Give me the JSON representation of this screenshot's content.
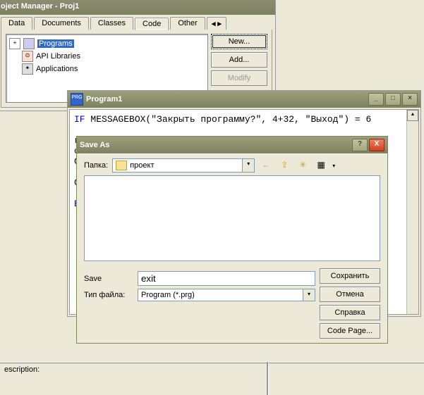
{
  "pm": {
    "title": "oject Manager - Proj1",
    "tabs": {
      "data": "Data",
      "documents": "Documents",
      "classes": "Classes",
      "code": "Code",
      "other": "Other",
      "add": "◂  ▸"
    },
    "tree": {
      "programs": "Programs",
      "api": "API Libraries",
      "apps": "Applications"
    },
    "buttons": {
      "new": "New...",
      "add": "Add...",
      "modify": "Modify"
    }
  },
  "ed": {
    "title": "Program1",
    "code": {
      "l1a": "IF",
      "l1b": " MESSAGEBOX(\"Закрыть программу?\", 4+32, \"Выход\") = 6",
      "l2": "   re",
      "l3": "clear",
      "l4": "   Cl",
      "l5": "   Cl",
      "l6": "ENDIF"
    }
  },
  "save": {
    "title": "Save As",
    "look_label": "Папка:",
    "folder": "проект",
    "name_label": "Save",
    "name_value": "exit",
    "type_label": "Тип файла:",
    "type_value": "Program (*.prg)",
    "btns": {
      "save": "Сохранить",
      "cancel": "Отмена",
      "help": "Справка",
      "cp": "Code Page..."
    },
    "help": "?",
    "close": "X"
  },
  "desc_label": "escription:",
  "icons": {
    "back": "←",
    "up": "⇪",
    "new": "✳",
    "views": "▦",
    "tri": "▾"
  }
}
